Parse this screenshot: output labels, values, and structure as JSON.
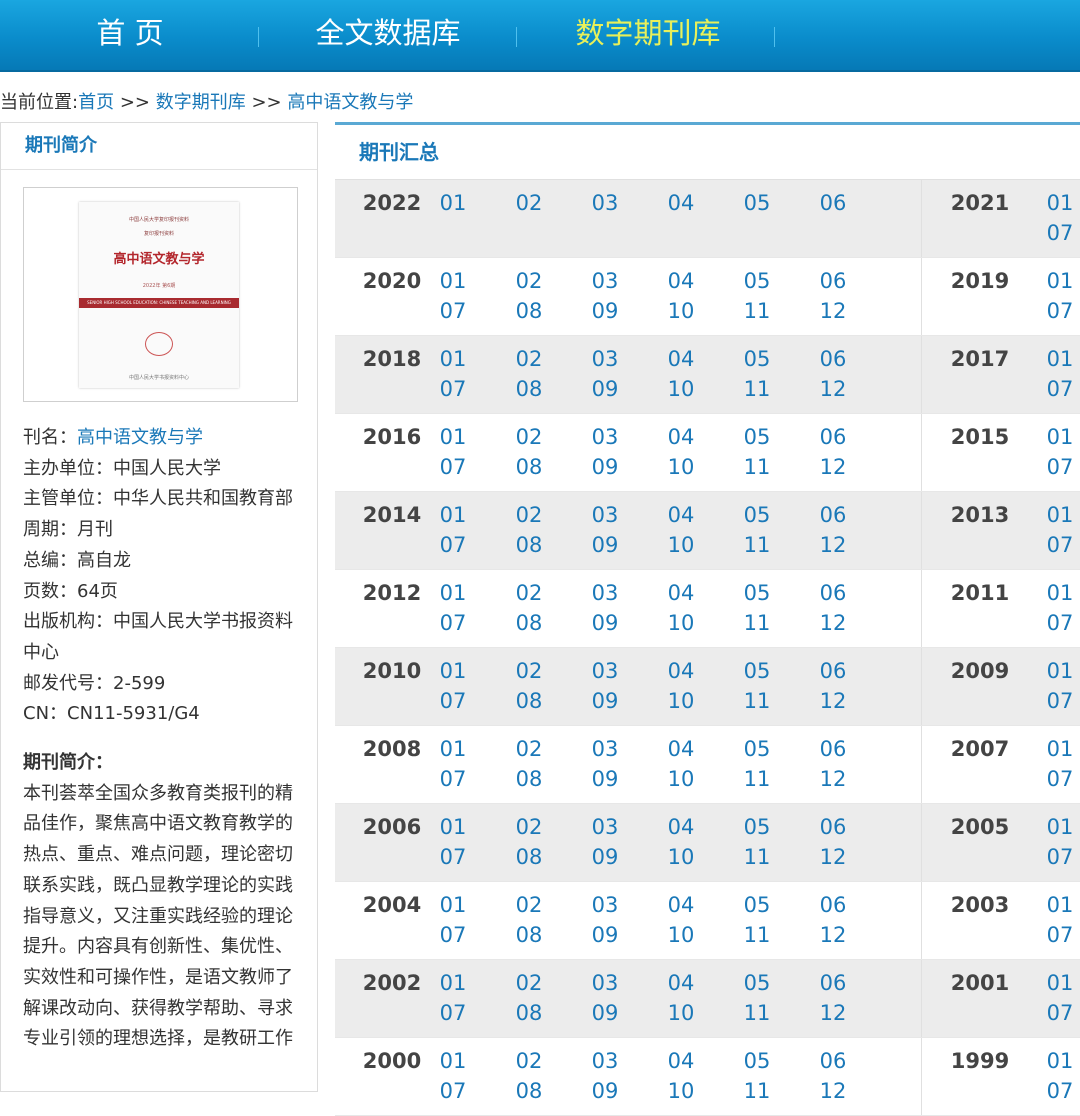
{
  "nav": {
    "items": [
      {
        "label": "首 页",
        "active": false
      },
      {
        "label": "全文数据库",
        "active": false
      },
      {
        "label": "数字期刊库",
        "active": true
      }
    ]
  },
  "breadcrumb": {
    "prefix": "当前位置:",
    "items": [
      "首页",
      "数字期刊库",
      "高中语文教与学"
    ],
    "separator": ">>"
  },
  "left": {
    "header": "期刊简介",
    "cover": {
      "small_top": "中国人民大学复印报刊资料",
      "small_sub": "复印报刊资料",
      "title": "高中语文教与学",
      "band": "SENIOR HIGH SCHOOL EDUCATION: CHINESE TEACHING AND LEARNING",
      "issue": "2022年 第6期",
      "publisher": "中国人民大学书报资料中心"
    },
    "info": {
      "name_label": "刊名：",
      "name_value": "高中语文教与学",
      "sponsor": "主办单位：中国人民大学",
      "supervisor": "主管单位：中华人民共和国教育部",
      "period": "周期：月刊",
      "editor": "总编：高自龙",
      "pages": "页数：64页",
      "publisher": "出版机构：中国人民大学书报资料中心",
      "postal": "邮发代号：2-599",
      "cn": "CN：CN11-5931/G4",
      "intro_heading": "期刊简介：",
      "intro_text": "本刊荟萃全国众多教育类报刊的精品佳作，聚焦高中语文教育教学的热点、重点、难点问题，理论密切联系实践，既凸显教学理论的实践指导意义，又注重实践经验的理论提升。内容具有创新性、集优性、实效性和可操作性，是语文教师了解课改动向、获得教学帮助、寻求专业引领的理想选择，是教研工作"
    }
  },
  "main": {
    "header": "期刊汇总",
    "rows": [
      {
        "left_year": "2022",
        "left_issues": [
          "01",
          "02",
          "03",
          "04",
          "05",
          "06"
        ],
        "right_year": "2021",
        "right_issues": [
          "01",
          "07"
        ]
      },
      {
        "left_year": "2020",
        "left_issues": [
          "01",
          "02",
          "03",
          "04",
          "05",
          "06",
          "07",
          "08",
          "09",
          "10",
          "11",
          "12"
        ],
        "right_year": "2019",
        "right_issues": [
          "01",
          "07"
        ]
      },
      {
        "left_year": "2018",
        "left_issues": [
          "01",
          "02",
          "03",
          "04",
          "05",
          "06",
          "07",
          "08",
          "09",
          "10",
          "11",
          "12"
        ],
        "right_year": "2017",
        "right_issues": [
          "01",
          "07"
        ]
      },
      {
        "left_year": "2016",
        "left_issues": [
          "01",
          "02",
          "03",
          "04",
          "05",
          "06",
          "07",
          "08",
          "09",
          "10",
          "11",
          "12"
        ],
        "right_year": "2015",
        "right_issues": [
          "01",
          "07"
        ]
      },
      {
        "left_year": "2014",
        "left_issues": [
          "01",
          "02",
          "03",
          "04",
          "05",
          "06",
          "07",
          "08",
          "09",
          "10",
          "11",
          "12"
        ],
        "right_year": "2013",
        "right_issues": [
          "01",
          "07"
        ]
      },
      {
        "left_year": "2012",
        "left_issues": [
          "01",
          "02",
          "03",
          "04",
          "05",
          "06",
          "07",
          "08",
          "09",
          "10",
          "11",
          "12"
        ],
        "right_year": "2011",
        "right_issues": [
          "01",
          "07"
        ]
      },
      {
        "left_year": "2010",
        "left_issues": [
          "01",
          "02",
          "03",
          "04",
          "05",
          "06",
          "07",
          "08",
          "09",
          "10",
          "11",
          "12"
        ],
        "right_year": "2009",
        "right_issues": [
          "01",
          "07"
        ]
      },
      {
        "left_year": "2008",
        "left_issues": [
          "01",
          "02",
          "03",
          "04",
          "05",
          "06",
          "07",
          "08",
          "09",
          "10",
          "11",
          "12"
        ],
        "right_year": "2007",
        "right_issues": [
          "01",
          "07"
        ]
      },
      {
        "left_year": "2006",
        "left_issues": [
          "01",
          "02",
          "03",
          "04",
          "05",
          "06",
          "07",
          "08",
          "09",
          "10",
          "11",
          "12"
        ],
        "right_year": "2005",
        "right_issues": [
          "01",
          "07"
        ]
      },
      {
        "left_year": "2004",
        "left_issues": [
          "01",
          "02",
          "03",
          "04",
          "05",
          "06",
          "07",
          "08",
          "09",
          "10",
          "11",
          "12"
        ],
        "right_year": "2003",
        "right_issues": [
          "01",
          "07"
        ]
      },
      {
        "left_year": "2002",
        "left_issues": [
          "01",
          "02",
          "03",
          "04",
          "05",
          "06",
          "07",
          "08",
          "09",
          "10",
          "11",
          "12"
        ],
        "right_year": "2001",
        "right_issues": [
          "01",
          "07"
        ]
      },
      {
        "left_year": "2000",
        "left_issues": [
          "01",
          "02",
          "03",
          "04",
          "05",
          "06",
          "07",
          "08",
          "09",
          "10",
          "11",
          "12"
        ],
        "right_year": "1999",
        "right_issues": [
          "01",
          "07"
        ]
      }
    ]
  }
}
